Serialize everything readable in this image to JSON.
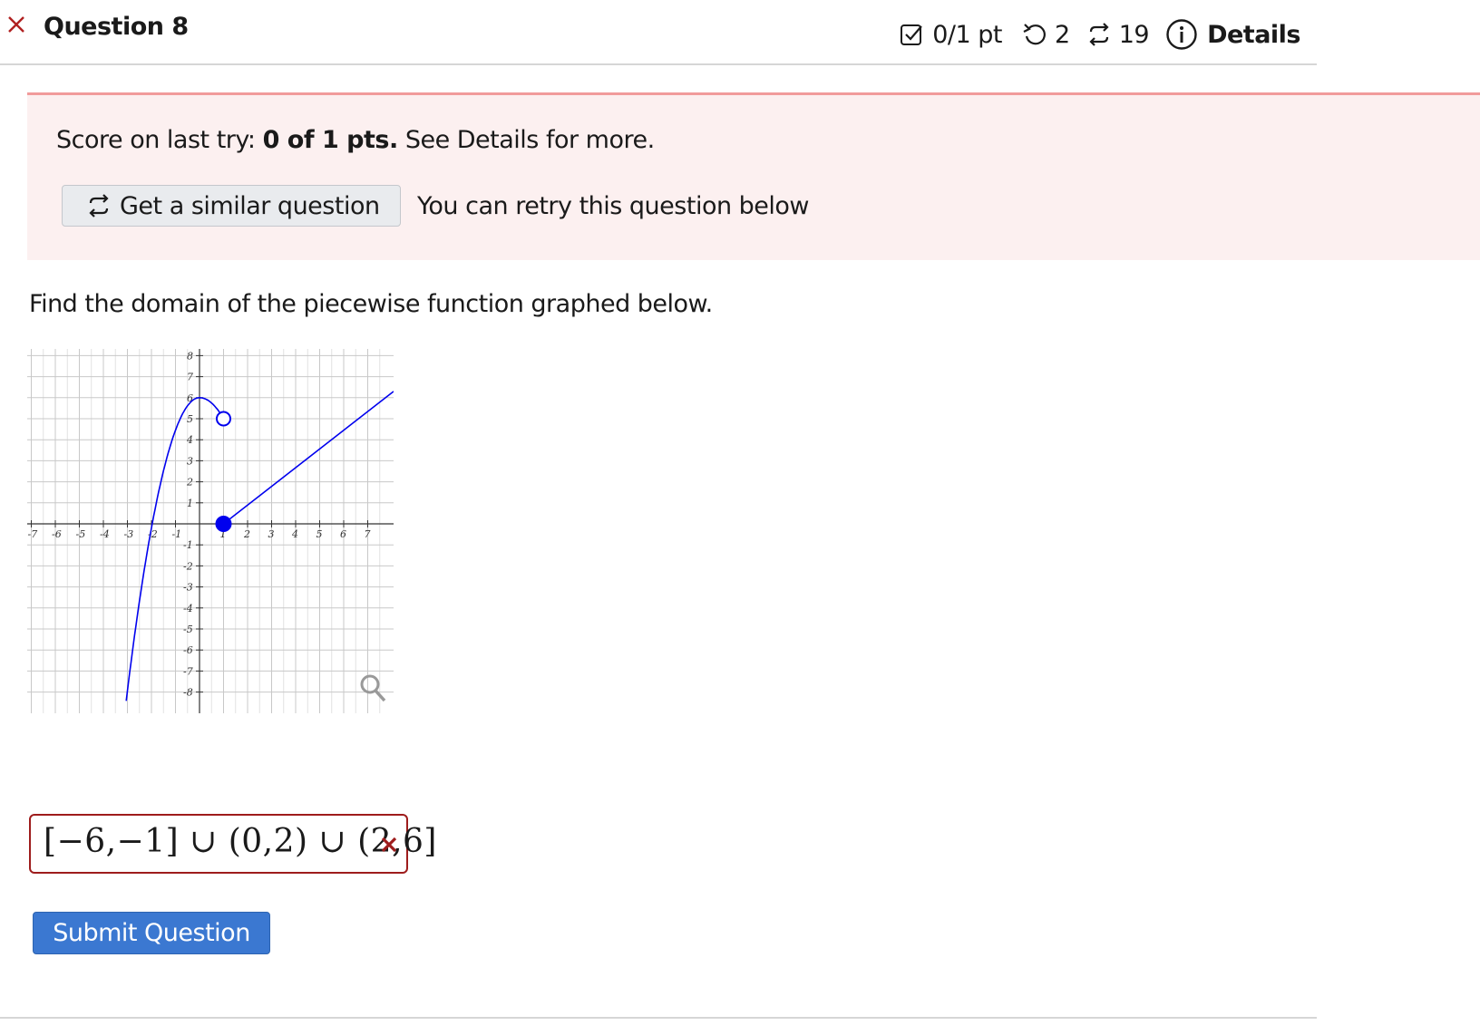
{
  "header": {
    "title": "Question 8",
    "score": "0/1 pt",
    "attempts": "2",
    "versions": "19",
    "details_label": "Details"
  },
  "alert": {
    "prefix": "Score on last try: ",
    "score": "0 of 1 pts.",
    "suffix": " See Details for more.",
    "similar_button": "Get a similar question",
    "retry_text": "You can retry this question below"
  },
  "question": {
    "prompt": "Find the domain of the piecewise function graphed below."
  },
  "graph": {
    "x_tick_labels": [
      "-7",
      "-6",
      "-5",
      "-4",
      "-3",
      "-2",
      "-1",
      "1",
      "2",
      "3",
      "4",
      "5",
      "6",
      "7"
    ],
    "y_tick_labels": [
      "8",
      "7",
      "6",
      "5",
      "4",
      "3",
      "2",
      "1",
      "-1",
      "-2",
      "-3",
      "-4",
      "-5",
      "-6",
      "-7",
      "-8"
    ],
    "curve_color": "#0000ee",
    "open_point": {
      "x": 1,
      "y": 5
    },
    "closed_point": {
      "x": 1,
      "y": 0
    },
    "zoom_icon": "magnifier-icon"
  },
  "answer": {
    "value": "[−6,−1] ∪ (0,2) ∪ (2,6]",
    "status": "incorrect",
    "status_color": "#9e1c1c"
  },
  "submit_label": "Submit Question"
}
